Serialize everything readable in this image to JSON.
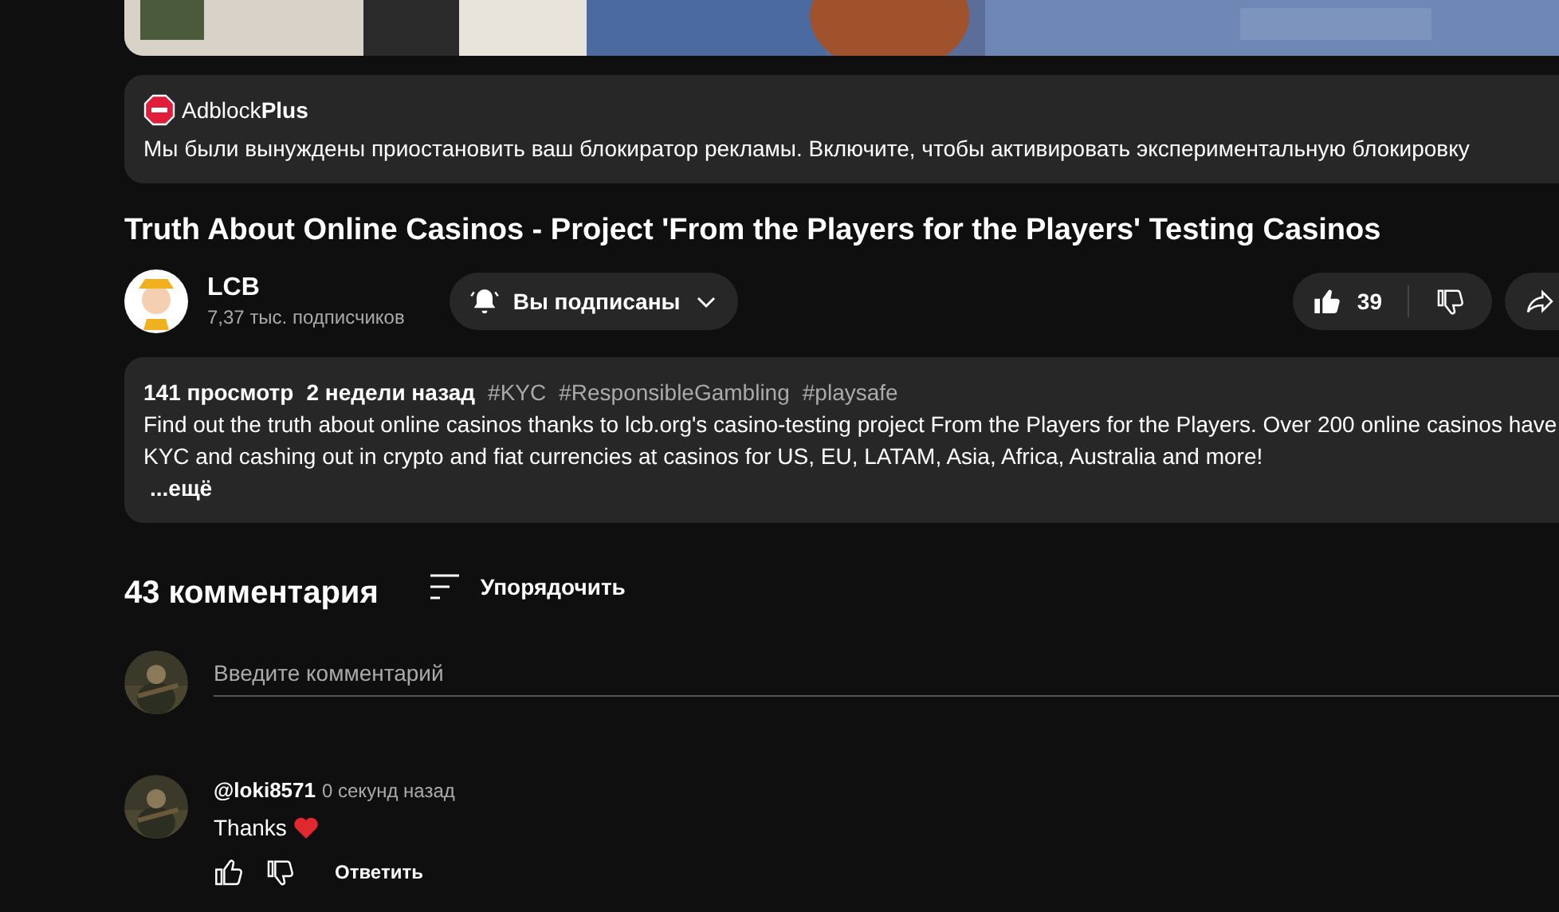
{
  "adblock": {
    "brand_light": "Adblock",
    "brand_bold": "Plus",
    "message": "Мы были вынуждены приостановить ваш блокиратор рекламы. Включите, чтобы активировать экспериментальную блокировку"
  },
  "video": {
    "title": "Truth About Online Casinos - Project 'From the Players for the Players' Testing Casinos",
    "channel": {
      "name": "LCB",
      "subscribers": "7,37 тыс. подписчиков"
    },
    "subscribe": {
      "label": "Вы подписаны",
      "subscribed": true
    },
    "likes": "39"
  },
  "description": {
    "views": "141 просмотр",
    "date": "2 недели назад",
    "hashtags": [
      "#KYC",
      "#ResponsibleGambling",
      "#playsafe"
    ],
    "lines": [
      "Find out the truth about online casinos thanks to lcb.org's casino-testing project From the Players for the Players. Over 200 online casinos have",
      "KYC and cashing out in crypto and fiat currencies at casinos for US, EU, LATAM, Asia, Africa, Australia and more!"
    ],
    "more": "...ещё"
  },
  "comments": {
    "count": "43 комментария",
    "sort": "Упорядочить",
    "input": {
      "placeholder": "Введите комментарий"
    },
    "items": [
      {
        "author": "@loki8571",
        "time": "0 секунд назад",
        "text": "Thanks",
        "heart": true,
        "reply": "Ответить"
      }
    ]
  }
}
